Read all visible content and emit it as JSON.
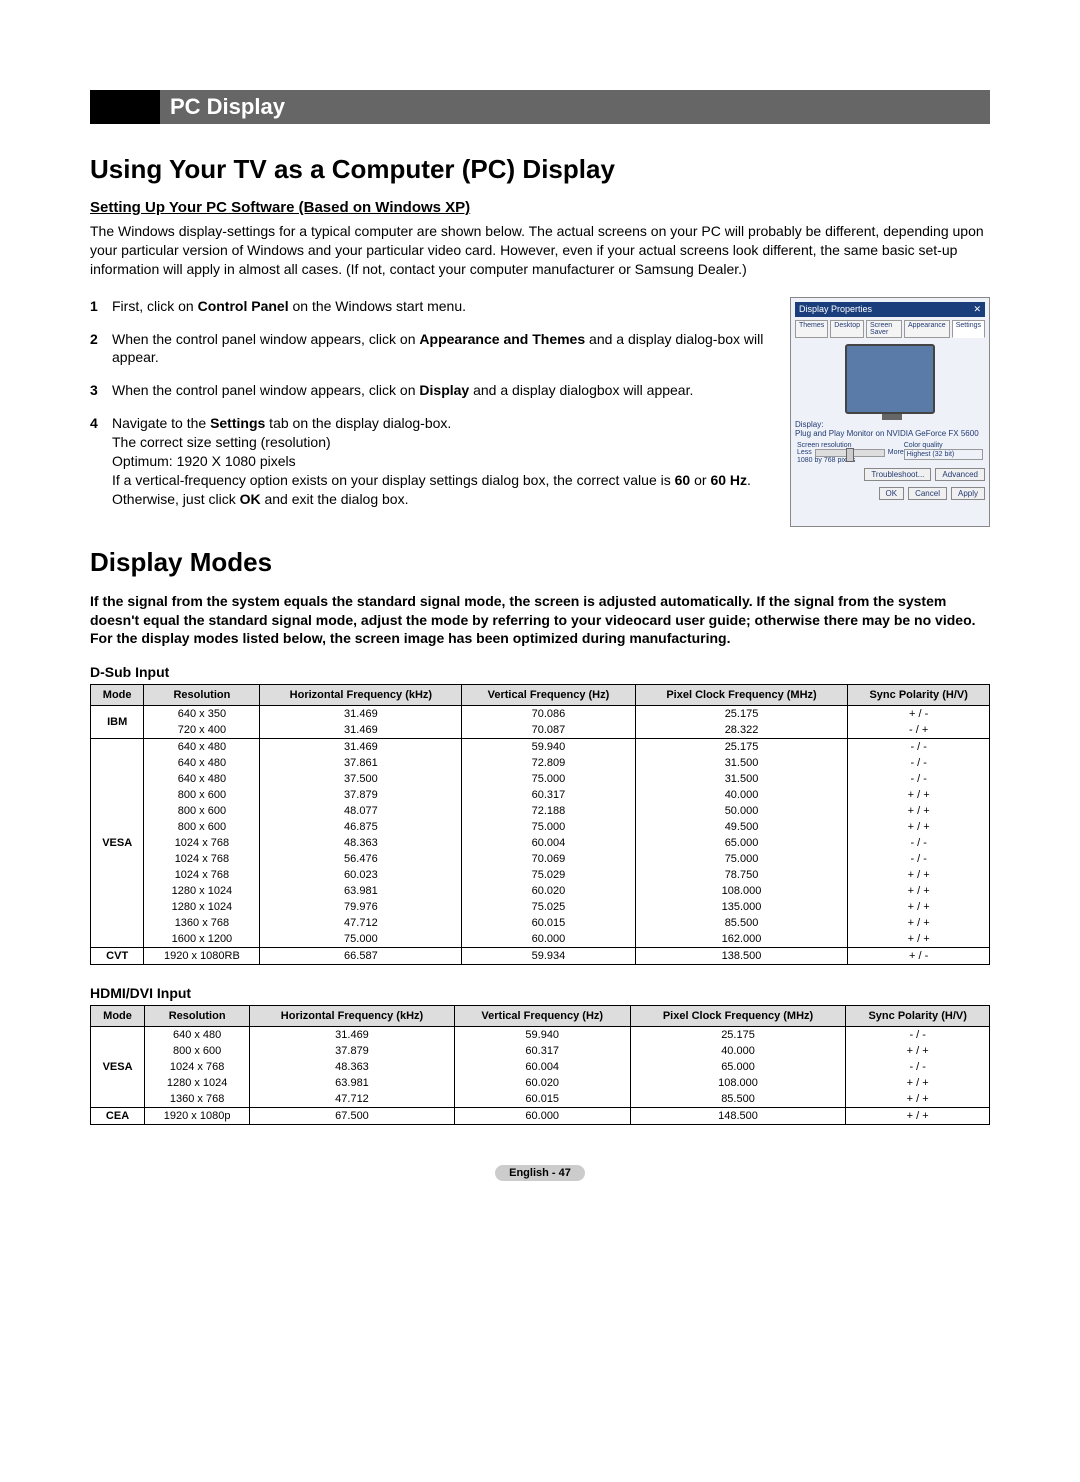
{
  "header": {
    "title": "PC Display"
  },
  "h1a": "Using Your TV as a Computer (PC) Display",
  "subsection": "Setting Up Your PC Software (Based on Windows XP)",
  "intro": "The Windows display-settings for a typical computer are shown below. The actual screens on your PC will probably be different, depending upon your particular version of Windows and your particular video card. However, even if your actual screens look different, the same basic set-up information will apply in almost all cases. (If not, contact your computer manufacturer or Samsung Dealer.)",
  "steps": {
    "s1": {
      "n": "1",
      "pre": "First, click on ",
      "bold1": "Control Panel",
      "post": " on the Windows start menu."
    },
    "s2": {
      "n": "2",
      "pre": "When the control panel window appears, click on ",
      "bold1": "Appearance and Themes",
      "post": " and a display dialog-box will appear."
    },
    "s3": {
      "n": "3",
      "pre": "When the control panel window appears, click on ",
      "bold1": "Display",
      "post": " and a display dialogbox will appear."
    },
    "s4": {
      "n": "4",
      "l1a": "Navigate to the ",
      "l1b": "Settings",
      "l1c": " tab on the display dialog-box.",
      "l2": "The correct size setting (resolution)",
      "l3": "Optimum: 1920 X 1080 pixels",
      "l4a": "If a vertical-frequency option exists on your display settings dialog box, the correct value is ",
      "l4b": "60",
      "l4c": " or ",
      "l4d": "60 Hz",
      "l4e": ". Otherwise, just click ",
      "l4f": "OK",
      "l4g": " and exit the dialog box."
    }
  },
  "dialog": {
    "title": "Display Properties",
    "tabs": [
      "Themes",
      "Desktop",
      "Screen Saver",
      "Appearance",
      "Settings"
    ],
    "display_label": "Display:",
    "display_value": "Plug and Play Monitor on NVIDIA GeForce FX 5600",
    "res_label": "Screen resolution",
    "less": "Less",
    "more": "More",
    "res_value": "1080 by 768 pixels",
    "cq_label": "Color quality",
    "cq_value": "Highest (32 bit)",
    "btn_ts": "Troubleshoot...",
    "btn_adv": "Advanced",
    "btn_ok": "OK",
    "btn_cancel": "Cancel",
    "btn_apply": "Apply"
  },
  "h1b": "Display Modes",
  "boldpara": "If the signal from the system equals the standard signal mode, the screen is adjusted automatically. If the signal from the system doesn't equal the standard signal mode, adjust the mode by referring to your videocard user guide; otherwise there may be no video. For the display modes listed below, the screen image has been optimized during manufacturing.",
  "dsub_title": "D-Sub Input",
  "hdmi_title": "HDMI/DVI Input",
  "columns": {
    "mode": "Mode",
    "res": "Resolution",
    "hf": "Horizontal Frequency (kHz)",
    "vf": "Vertical Frequency (Hz)",
    "pc": "Pixel Clock Frequency (MHz)",
    "sp": "Sync Polarity (H/V)"
  },
  "dsub": [
    {
      "mode": "IBM",
      "rows": [
        [
          "640 x 350",
          "31.469",
          "70.086",
          "25.175",
          "+ / -"
        ],
        [
          "720 x 400",
          "31.469",
          "70.087",
          "28.322",
          "- / +"
        ]
      ]
    },
    {
      "mode": "VESA",
      "rows": [
        [
          "640 x 480",
          "31.469",
          "59.940",
          "25.175",
          "- / -"
        ],
        [
          "640 x 480",
          "37.861",
          "72.809",
          "31.500",
          "- / -"
        ],
        [
          "640 x 480",
          "37.500",
          "75.000",
          "31.500",
          "- / -"
        ],
        [
          "800 x 600",
          "37.879",
          "60.317",
          "40.000",
          "+ / +"
        ],
        [
          "800 x 600",
          "48.077",
          "72.188",
          "50.000",
          "+ / +"
        ],
        [
          "800 x 600",
          "46.875",
          "75.000",
          "49.500",
          "+ / +"
        ],
        [
          "1024 x 768",
          "48.363",
          "60.004",
          "65.000",
          "- / -"
        ],
        [
          "1024 x 768",
          "56.476",
          "70.069",
          "75.000",
          "- / -"
        ],
        [
          "1024 x 768",
          "60.023",
          "75.029",
          "78.750",
          "+ / +"
        ],
        [
          "1280 x 1024",
          "63.981",
          "60.020",
          "108.000",
          "+ / +"
        ],
        [
          "1280 x 1024",
          "79.976",
          "75.025",
          "135.000",
          "+ / +"
        ],
        [
          "1360 x 768",
          "47.712",
          "60.015",
          "85.500",
          "+ / +"
        ],
        [
          "1600 x 1200",
          "75.000",
          "60.000",
          "162.000",
          "+ / +"
        ]
      ]
    },
    {
      "mode": "CVT",
      "rows": [
        [
          "1920 x 1080RB",
          "66.587",
          "59.934",
          "138.500",
          "+ / -"
        ]
      ]
    }
  ],
  "hdmi": [
    {
      "mode": "VESA",
      "rows": [
        [
          "640 x 480",
          "31.469",
          "59.940",
          "25.175",
          "- / -"
        ],
        [
          "800 x 600",
          "37.879",
          "60.317",
          "40.000",
          "+ / +"
        ],
        [
          "1024 x 768",
          "48.363",
          "60.004",
          "65.000",
          "- / -"
        ],
        [
          "1280 x 1024",
          "63.981",
          "60.020",
          "108.000",
          "+ / +"
        ],
        [
          "1360 x 768",
          "47.712",
          "60.015",
          "85.500",
          "+ / +"
        ]
      ]
    },
    {
      "mode": "CEA",
      "rows": [
        [
          "1920 x 1080p",
          "67.500",
          "60.000",
          "148.500",
          "+ / +"
        ]
      ]
    }
  ],
  "footer": {
    "lang": "English - ",
    "page": "47"
  }
}
